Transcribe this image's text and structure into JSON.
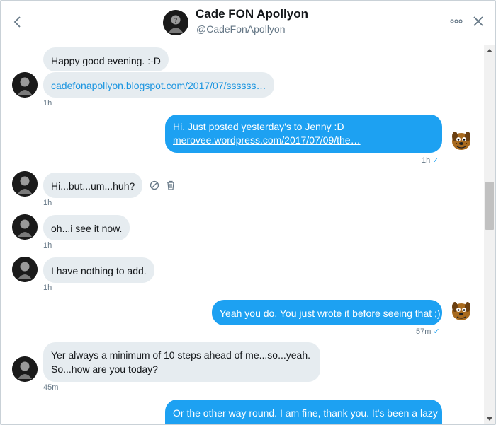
{
  "header": {
    "back_icon": "chevron-left-icon",
    "name": "Cade FON Apollyon",
    "handle": "@CadeFonApollyon",
    "more_icon": "more-horizontal-icon",
    "close_icon": "close-icon"
  },
  "colors": {
    "accent": "#1da1f2",
    "incoming_bubble": "#e6ecf0",
    "secondary_text": "#657786",
    "link": "#1b95e0"
  },
  "messages": [
    {
      "from": "them",
      "text": "Happy good evening. :-D"
    },
    {
      "from": "them",
      "link": "cadefonapollyon.blogspot.com/2017/07/ssssss…",
      "time": "1h"
    },
    {
      "from": "me",
      "text": "Hi. Just posted yesterday's to Jenny :D",
      "link": "merovee.wordpress.com/2017/07/09/the…",
      "time": "1h",
      "status": "✓"
    },
    {
      "from": "them",
      "text": "Hi...but...um...huh?",
      "time": "1h",
      "actions": [
        "block-icon",
        "trash-icon"
      ]
    },
    {
      "from": "them",
      "text": "oh...i see it now.",
      "time": "1h"
    },
    {
      "from": "them",
      "text": "I have nothing to add.",
      "time": "1h"
    },
    {
      "from": "me",
      "text": "Yeah you do, You just wrote it before seeing that ;)",
      "time": "57m",
      "status": "✓"
    },
    {
      "from": "them",
      "lines": [
        "Yer always a minimum of 10 steps ahead of me...so...yeah.",
        "So...how are you today?"
      ],
      "time": "45m"
    },
    {
      "from": "me",
      "text": "Or the other way round. I am fine, thank you. It's been a lazy"
    }
  ]
}
